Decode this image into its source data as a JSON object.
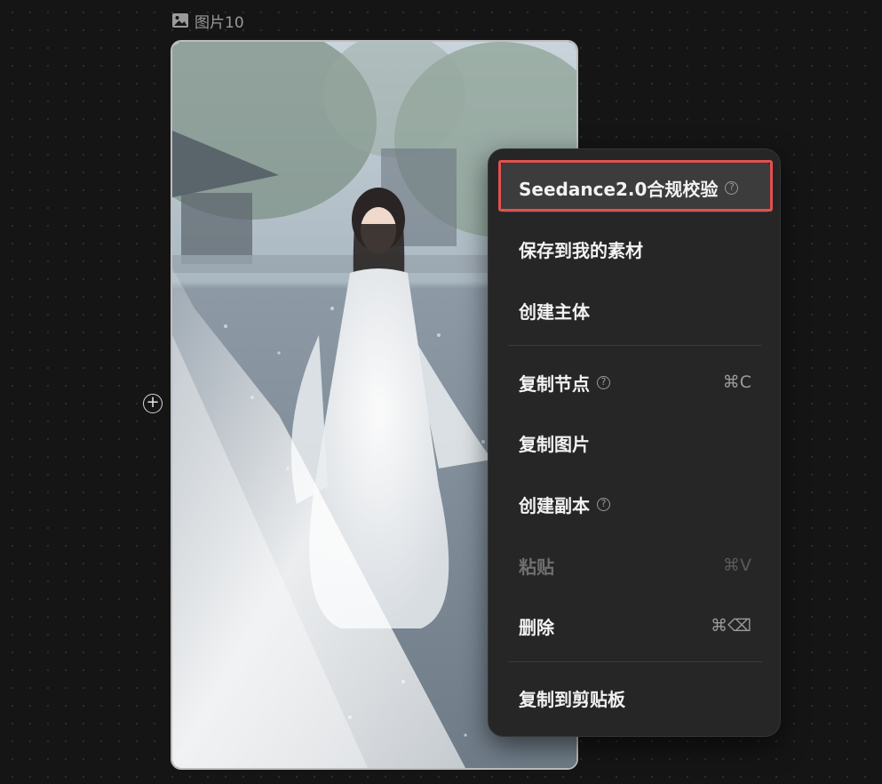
{
  "node": {
    "title": "图片10",
    "icon": "image-icon"
  },
  "add_icon": "plus-circle-icon",
  "context_menu": {
    "items": [
      {
        "label": "Seedance2.0合规校验",
        "help": true,
        "shortcut": "",
        "disabled": false,
        "highlighted": true
      },
      {
        "label": "保存到我的素材",
        "help": false,
        "shortcut": "",
        "disabled": false
      },
      {
        "label": "创建主体",
        "help": false,
        "shortcut": "",
        "disabled": false
      },
      {
        "label": "复制节点",
        "help": true,
        "shortcut": "⌘C",
        "disabled": false
      },
      {
        "label": "复制图片",
        "help": false,
        "shortcut": "",
        "disabled": false
      },
      {
        "label": "创建副本",
        "help": true,
        "shortcut": "",
        "disabled": false
      },
      {
        "label": "粘贴",
        "help": false,
        "shortcut": "⌘V",
        "disabled": true
      },
      {
        "label": "删除",
        "help": false,
        "shortcut": "⌘⌫",
        "disabled": false
      },
      {
        "label": "复制到剪贴板",
        "help": false,
        "shortcut": "",
        "disabled": false
      }
    ]
  },
  "colors": {
    "canvas_bg": "#151515",
    "menu_bg": "#262626",
    "highlight_border": "#e2514f"
  }
}
